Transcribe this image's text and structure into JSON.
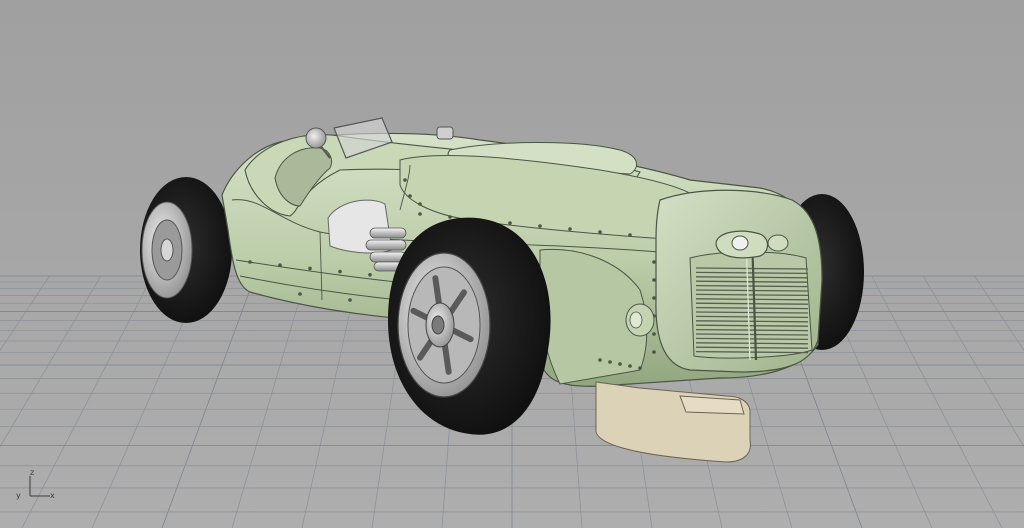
{
  "viewport": {
    "background_color": "#a5a5a5",
    "grid_color": "#8e939a",
    "grid_major_color": "#7d838c",
    "model": {
      "name": "vintage-race-car",
      "body_color": "#bfd0ad",
      "body_shadow_color": "#8fa37e",
      "tire_color": "#1b1b1b",
      "wheel_color": "#c7c7c7",
      "skid_plate_color": "#d8ceb5",
      "exhaust_color": "#dcdcdc"
    },
    "axis_widget": {
      "z_label": "z",
      "y_label": "y",
      "x_label": "x"
    }
  }
}
